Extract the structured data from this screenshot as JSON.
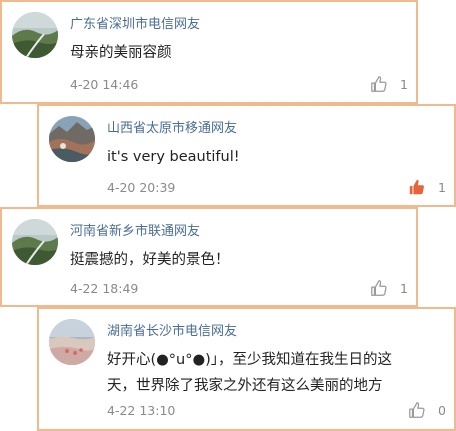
{
  "comments": [
    {
      "user": "广东省深圳市电信网友",
      "text": "母亲的美丽容颜",
      "time": "4-20 14:46",
      "likes": "1",
      "liked": false
    },
    {
      "user": "山西省太原市移通网友",
      "text": "it's very beautiful!",
      "time": "4-20 20:39",
      "likes": "1",
      "liked": true
    },
    {
      "user": "河南省新乡市联通网友",
      "text": "挺震撼的，好美的景色！",
      "time": "4-22 18:49",
      "likes": "1",
      "liked": false
    },
    {
      "user": "湖南省长沙市电信网友",
      "text_line1": "好开心(●°u°●)」，至少我知道在我生日的这",
      "text_line2": "天，世界除了我家之外还有这么美丽的地方",
      "time": "4-22 13:10",
      "likes": "0",
      "liked": false
    }
  ],
  "colors": {
    "card_border": "#f1b98e",
    "username": "#4a6d95",
    "like_active": "#e8623a",
    "like_inactive": "#9a9a9a"
  },
  "icons": {
    "like": "thumbs-up-icon"
  }
}
